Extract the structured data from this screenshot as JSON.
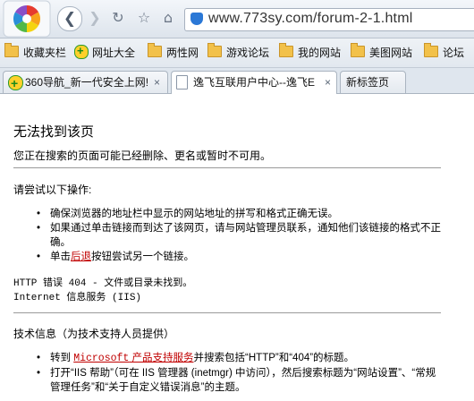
{
  "toolbar": {
    "url": "www.773sy.com/forum-2-1.html",
    "nav": {
      "back": "❮",
      "forward": "❯",
      "refresh": "↻",
      "star": "☆",
      "home": "⌂"
    }
  },
  "bookmarks": [
    {
      "label": "收藏夹栏",
      "icon": "folder-icon"
    },
    {
      "label": "网址大全",
      "icon": "globe-icon"
    },
    {
      "label": "两性网",
      "icon": "folder-icon"
    },
    {
      "label": "游戏论坛",
      "icon": "folder-icon"
    },
    {
      "label": "我的网站",
      "icon": "folder-icon"
    },
    {
      "label": "美图网站",
      "icon": "folder-icon"
    },
    {
      "label": "论坛",
      "icon": "folder-icon"
    }
  ],
  "tabs": [
    {
      "label": "360导航_新一代安全上网!",
      "close": "×"
    },
    {
      "label": "逸飞互联用户中心--逸飞E",
      "close": "×"
    },
    {
      "label": "新标签页"
    }
  ],
  "page": {
    "title": "无法找到该页",
    "description": "您正在搜索的页面可能已经删除、更名或暂时不可用。",
    "try_heading": "请尝试以下操作:",
    "try_items": {
      "item1": "确保浏览器的地址栏中显示的网站地址的拼写和格式正确无误。",
      "item2": "如果通过单击链接而到达了该网页，请与网站管理员联系，通知他们该链接的格式不正确。",
      "item3_pre": "单击",
      "item3_link": "后退",
      "item3_post": "按钮尝试另一个链接。"
    },
    "error_line1": "HTTP 错误 404 - 文件或目录未找到。",
    "error_line2": "Internet 信息服务 (IIS)",
    "tech_heading": "技术信息（为技术支持人员提供）",
    "tech_items": {
      "item1_pre": "转到 ",
      "item1_link_brand": "Microsoft",
      "item1_link": " 产品支持服务",
      "item1_post": "并搜索包括“HTTP”和“404”的标题。",
      "item2": "打开“IIS 帮助”（可在 IIS 管理器 (inetmgr) 中访问），然后搜索标题为“网站设置”、“常规管理任务”和“关于自定义错误消息”的主题。"
    }
  },
  "colors": {
    "link": "#c00000",
    "url_shield": "#2b78d6"
  }
}
